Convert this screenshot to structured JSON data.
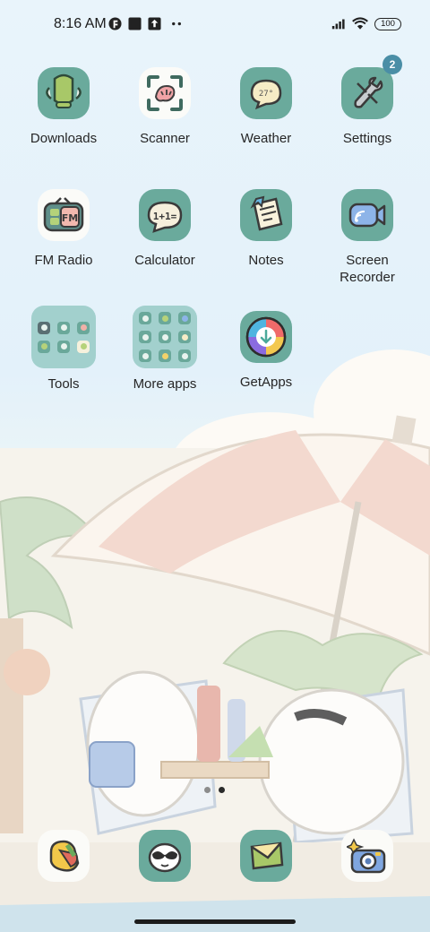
{
  "status_bar": {
    "time": "8:16 AM",
    "battery": "100",
    "icons": [
      "circle-f-icon",
      "square-icon",
      "upload-icon",
      "more-dots-icon",
      "signal-icon",
      "wifi-icon",
      "battery-icon"
    ]
  },
  "apps": [
    {
      "label": "Downloads",
      "icon": "downloads-icon"
    },
    {
      "label": "Scanner",
      "icon": "scanner-icon"
    },
    {
      "label": "Weather",
      "icon": "weather-icon"
    },
    {
      "label": "Settings",
      "icon": "settings-icon",
      "badge": "2"
    },
    {
      "label": "FM Radio",
      "icon": "fm-radio-icon",
      "icon_text": "FM"
    },
    {
      "label": "Calculator",
      "icon": "calculator-icon",
      "icon_text": "1+1="
    },
    {
      "label": "Notes",
      "icon": "notes-icon"
    },
    {
      "label": "Screen\nRecorder",
      "line1": "Screen",
      "line2": "Recorder",
      "icon": "screen-recorder-icon"
    },
    {
      "label": "Tools",
      "icon": "folder-icon"
    },
    {
      "label": "More apps",
      "icon": "folder-icon"
    },
    {
      "label": "GetApps",
      "icon": "getapps-icon"
    }
  ],
  "weather_icon_text": "27°",
  "page_indicator": {
    "pages": 2,
    "current": 2
  },
  "dock": [
    {
      "name": "phone-dock-icon"
    },
    {
      "name": "messaging-dock-icon"
    },
    {
      "name": "browser-dock-icon"
    },
    {
      "name": "camera-dock-icon"
    }
  ],
  "colors": {
    "icon_teal": "#6aaa9c",
    "badge": "#4a8ea6",
    "label": "#262626"
  }
}
